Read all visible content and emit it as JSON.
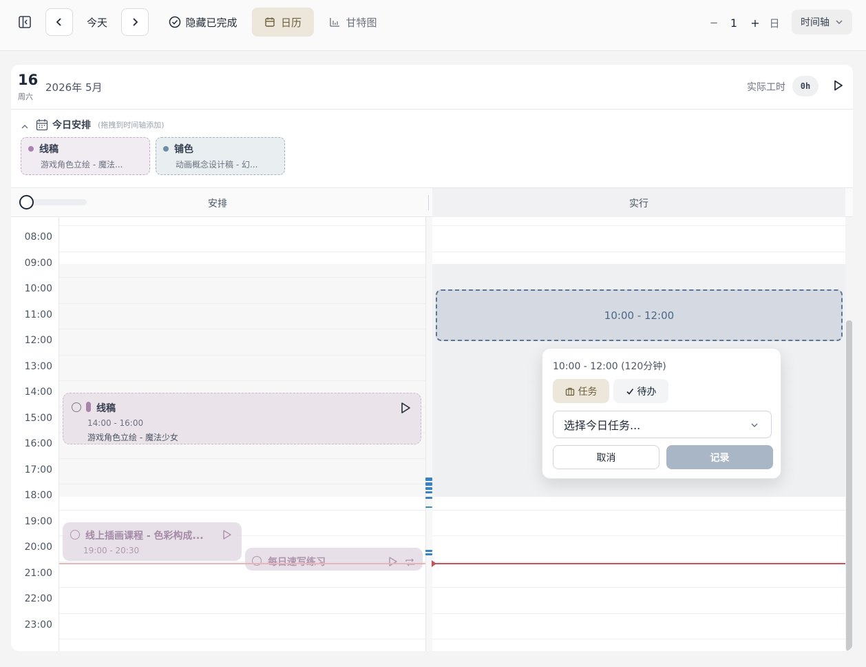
{
  "toolbar": {
    "today_label": "今天",
    "hide_completed_label": "隐藏已完成",
    "calendar_label": "日历",
    "gantt_label": "甘特图",
    "zoom_minus": "−",
    "zoom_value": "1",
    "zoom_plus": "+",
    "zoom_unit": "日",
    "view_select": "时间轴"
  },
  "date_header": {
    "day": "16",
    "weekday": "周六",
    "year_month": "2026年 5月",
    "worktime_label": "实际工时",
    "worktime_value": "0h"
  },
  "today_plan": {
    "title": "今日安排",
    "hint": "(拖拽到时间轴添加)",
    "chips": [
      {
        "name": "线稿",
        "desc": "游戏角色立绘 - 魔法...",
        "color": "#a684ac"
      },
      {
        "name": "铺色",
        "desc": "动画概念设计稿 - 幻...",
        "color": "#6e8ea6"
      }
    ]
  },
  "columns": {
    "plan": "安排",
    "exec": "实行"
  },
  "hours": [
    "08:00",
    "09:00",
    "10:00",
    "11:00",
    "12:00",
    "13:00",
    "14:00",
    "15:00",
    "16:00",
    "17:00",
    "18:00",
    "19:00",
    "20:00",
    "21:00",
    "22:00",
    "23:00"
  ],
  "events": {
    "e1": {
      "title": "线稿",
      "time": "14:00 - 16:00",
      "sub": "游戏角色立绘 - 魔法少女"
    },
    "e2": {
      "title": "线上插画课程 - 色彩构成...",
      "time": "19:00 - 20:30"
    },
    "e3": {
      "title": "每日速写练习"
    }
  },
  "exec_block": {
    "time": "10:00 - 12:00"
  },
  "popover": {
    "range": "10:00 - 12:00 (120分钟)",
    "tab_task": "任务",
    "tab_todo": "待办",
    "select_placeholder": "选择今日任务...",
    "cancel": "取消",
    "record": "记录"
  },
  "colors": {
    "accent_bg": "#ece7da",
    "plan_purple": "#a684ac",
    "now_line": "#c5535c",
    "exec_dashed": "#5d7595"
  }
}
